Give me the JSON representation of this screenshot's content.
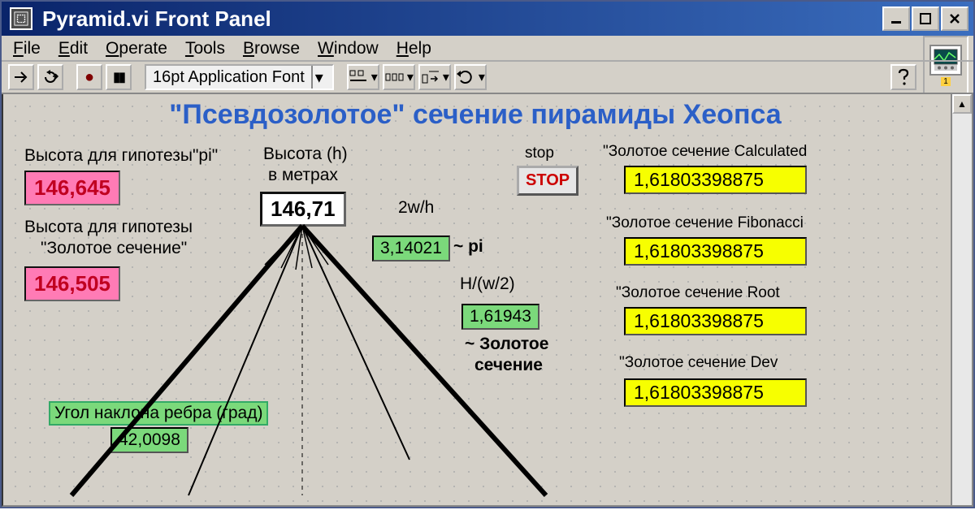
{
  "window": {
    "title": "Pyramid.vi Front Panel"
  },
  "menu": {
    "file": "File",
    "edit": "Edit",
    "operate": "Operate",
    "tools": "Tools",
    "browse": "Browse",
    "window": "Window",
    "help": "Help"
  },
  "toolbar": {
    "font_label": "16pt Application Font",
    "panel_badge": "1"
  },
  "main": {
    "title": "\"Псевдозолотое\" сечение пирамиды Хеопса",
    "height_pi_label": "Высота для гипотезы\"pi\"",
    "height_pi_value": "146,645",
    "height_gold_label1": "Высота для гипотезы",
    "height_gold_label2": "\"Золотое сечение\"",
    "height_gold_value": "146,505",
    "height_h_label1": "Высота (h)",
    "height_h_label2": "в метрах",
    "height_h_value": "146,71",
    "two_w_h_label": "2w/h",
    "two_w_h_value": "3,14021",
    "approx_pi": "~ pi",
    "h_w2_label": "H/(w/2)",
    "h_w2_value": "1,61943",
    "approx_gold1": "~ Золотое",
    "approx_gold2": "сечение",
    "edge_angle_label": "Угол наклона ребра (град)",
    "edge_angle_value": "42,0098",
    "stop_label": "stop",
    "stop_button": "STOP",
    "gold_calc_label": "\"Золотое сечение Calculated",
    "gold_calc_value": "1,61803398875",
    "gold_fib_label": "\"Золотое сечение Fibonacci",
    "gold_fib_value": "1,61803398875",
    "gold_root_label": "\"Золотое сечение Root",
    "gold_root_value": "1,61803398875",
    "gold_dev_label": "\"Золотое сечение Dev",
    "gold_dev_value": "1,61803398875"
  }
}
